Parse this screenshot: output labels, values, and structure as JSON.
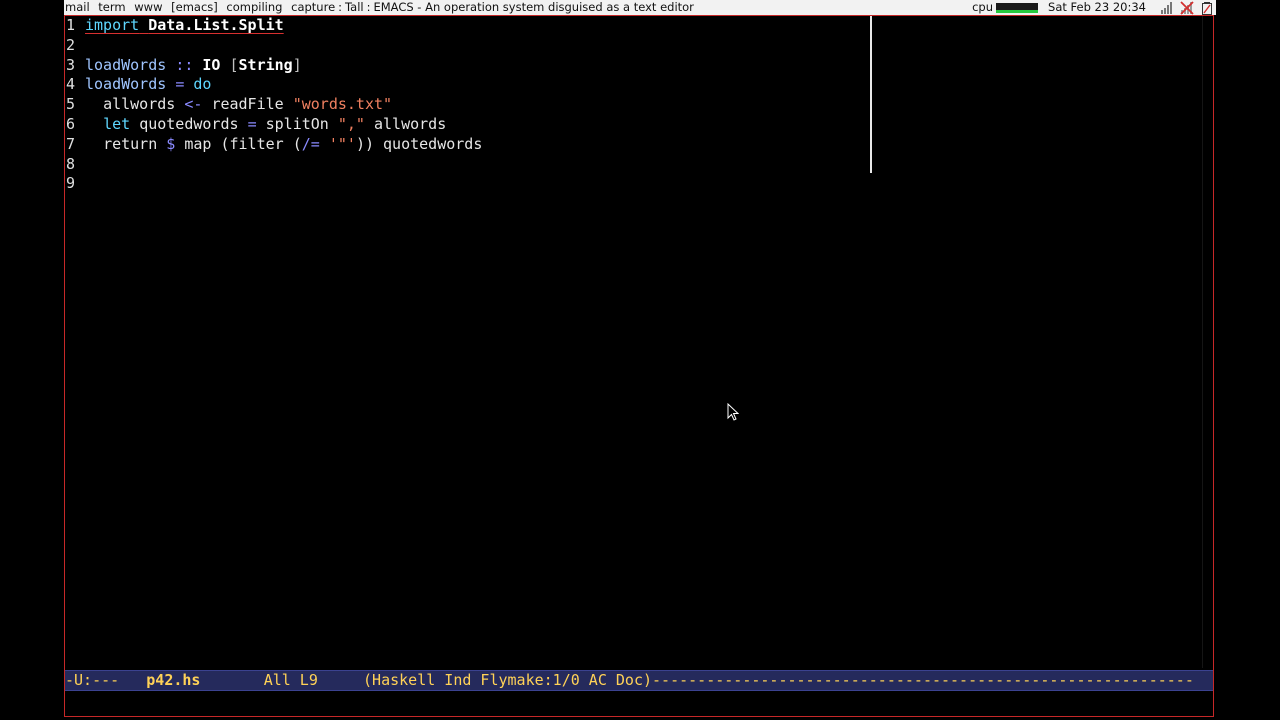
{
  "topbar": {
    "tags": [
      "mail",
      "term",
      "www",
      "[emacs]",
      "compiling",
      "capture"
    ],
    "layout": "Tall",
    "window_title": "EMACS - An operation system disguised as a text editor",
    "cpu_label": "cpu",
    "cpu_load_fraction": 0.05,
    "clock": "Sat Feb 23 20:34",
    "tray_icons": [
      "network-signal-icon",
      "network-disabled-icon",
      "battery-icon"
    ]
  },
  "editor": {
    "lines": [
      {
        "number": "1"
      },
      {
        "number": "2"
      },
      {
        "number": "3"
      },
      {
        "number": "4"
      },
      {
        "number": "5"
      },
      {
        "number": "6"
      },
      {
        "number": "7"
      },
      {
        "number": "8"
      },
      {
        "number": "9"
      }
    ],
    "tokens": {
      "l1_import": "import",
      "l1_module": "Data.List.Split",
      "l3_name": "loadWords",
      "l3_sig": "::",
      "l3_io": "IO",
      "l3_open": "[",
      "l3_string": "String",
      "l3_close": "]",
      "l4_name": "loadWords",
      "l4_eq": "=",
      "l4_do": "do",
      "l5_var": "allwords",
      "l5_bind": "<-",
      "l5_fn": "readFile",
      "l5_str": "\"words.txt\"",
      "l6_let": "let",
      "l6_var": "quotedwords",
      "l6_eq": "=",
      "l6_fn": "splitOn",
      "l6_str": "\",\"",
      "l6_arg": "allwords",
      "l7_return": "return",
      "l7_dollar": "$",
      "l7_map": "map",
      "l7_open": "(filter (",
      "l7_neq": "/=",
      "l7_str": "'\"'",
      "l7_close": "))",
      "l7_arg": "quotedwords"
    }
  },
  "modeline": {
    "status": "-U:---",
    "buffer_name": "p42.hs",
    "position": "All L9",
    "modes": "(Haskell Ind Flymake:1/0 AC Doc)",
    "dashes": "------------------------------------------------------------"
  },
  "colors": {
    "frame_border": "#c62828",
    "modeline_bg": "#252a5c",
    "modeline_fg": "#ffd257",
    "keyword": "#5fd7ff",
    "string": "#f08060",
    "operator": "#8a8aff"
  }
}
